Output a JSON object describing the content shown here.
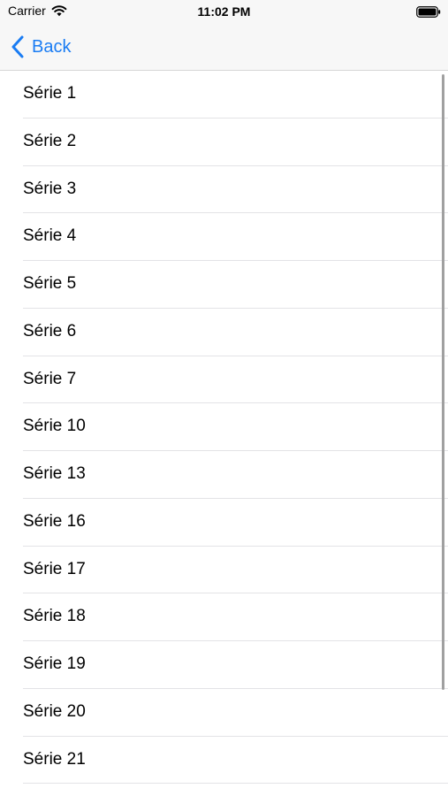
{
  "status_bar": {
    "carrier": "Carrier",
    "time": "11:02 PM",
    "icons": [
      "wifi-icon",
      "battery-icon"
    ]
  },
  "nav": {
    "back_label": "Back",
    "accent_color": "#1a7cf3"
  },
  "list": {
    "items": [
      {
        "label": "Série 1"
      },
      {
        "label": "Série 2"
      },
      {
        "label": "Série 3"
      },
      {
        "label": "Série 4"
      },
      {
        "label": "Série 5"
      },
      {
        "label": "Série 6"
      },
      {
        "label": "Série 7"
      },
      {
        "label": "Série 10"
      },
      {
        "label": "Série 13"
      },
      {
        "label": "Série 16"
      },
      {
        "label": "Série 17"
      },
      {
        "label": "Série 18"
      },
      {
        "label": "Série 19"
      },
      {
        "label": "Série 20"
      },
      {
        "label": "Série 21"
      }
    ]
  }
}
